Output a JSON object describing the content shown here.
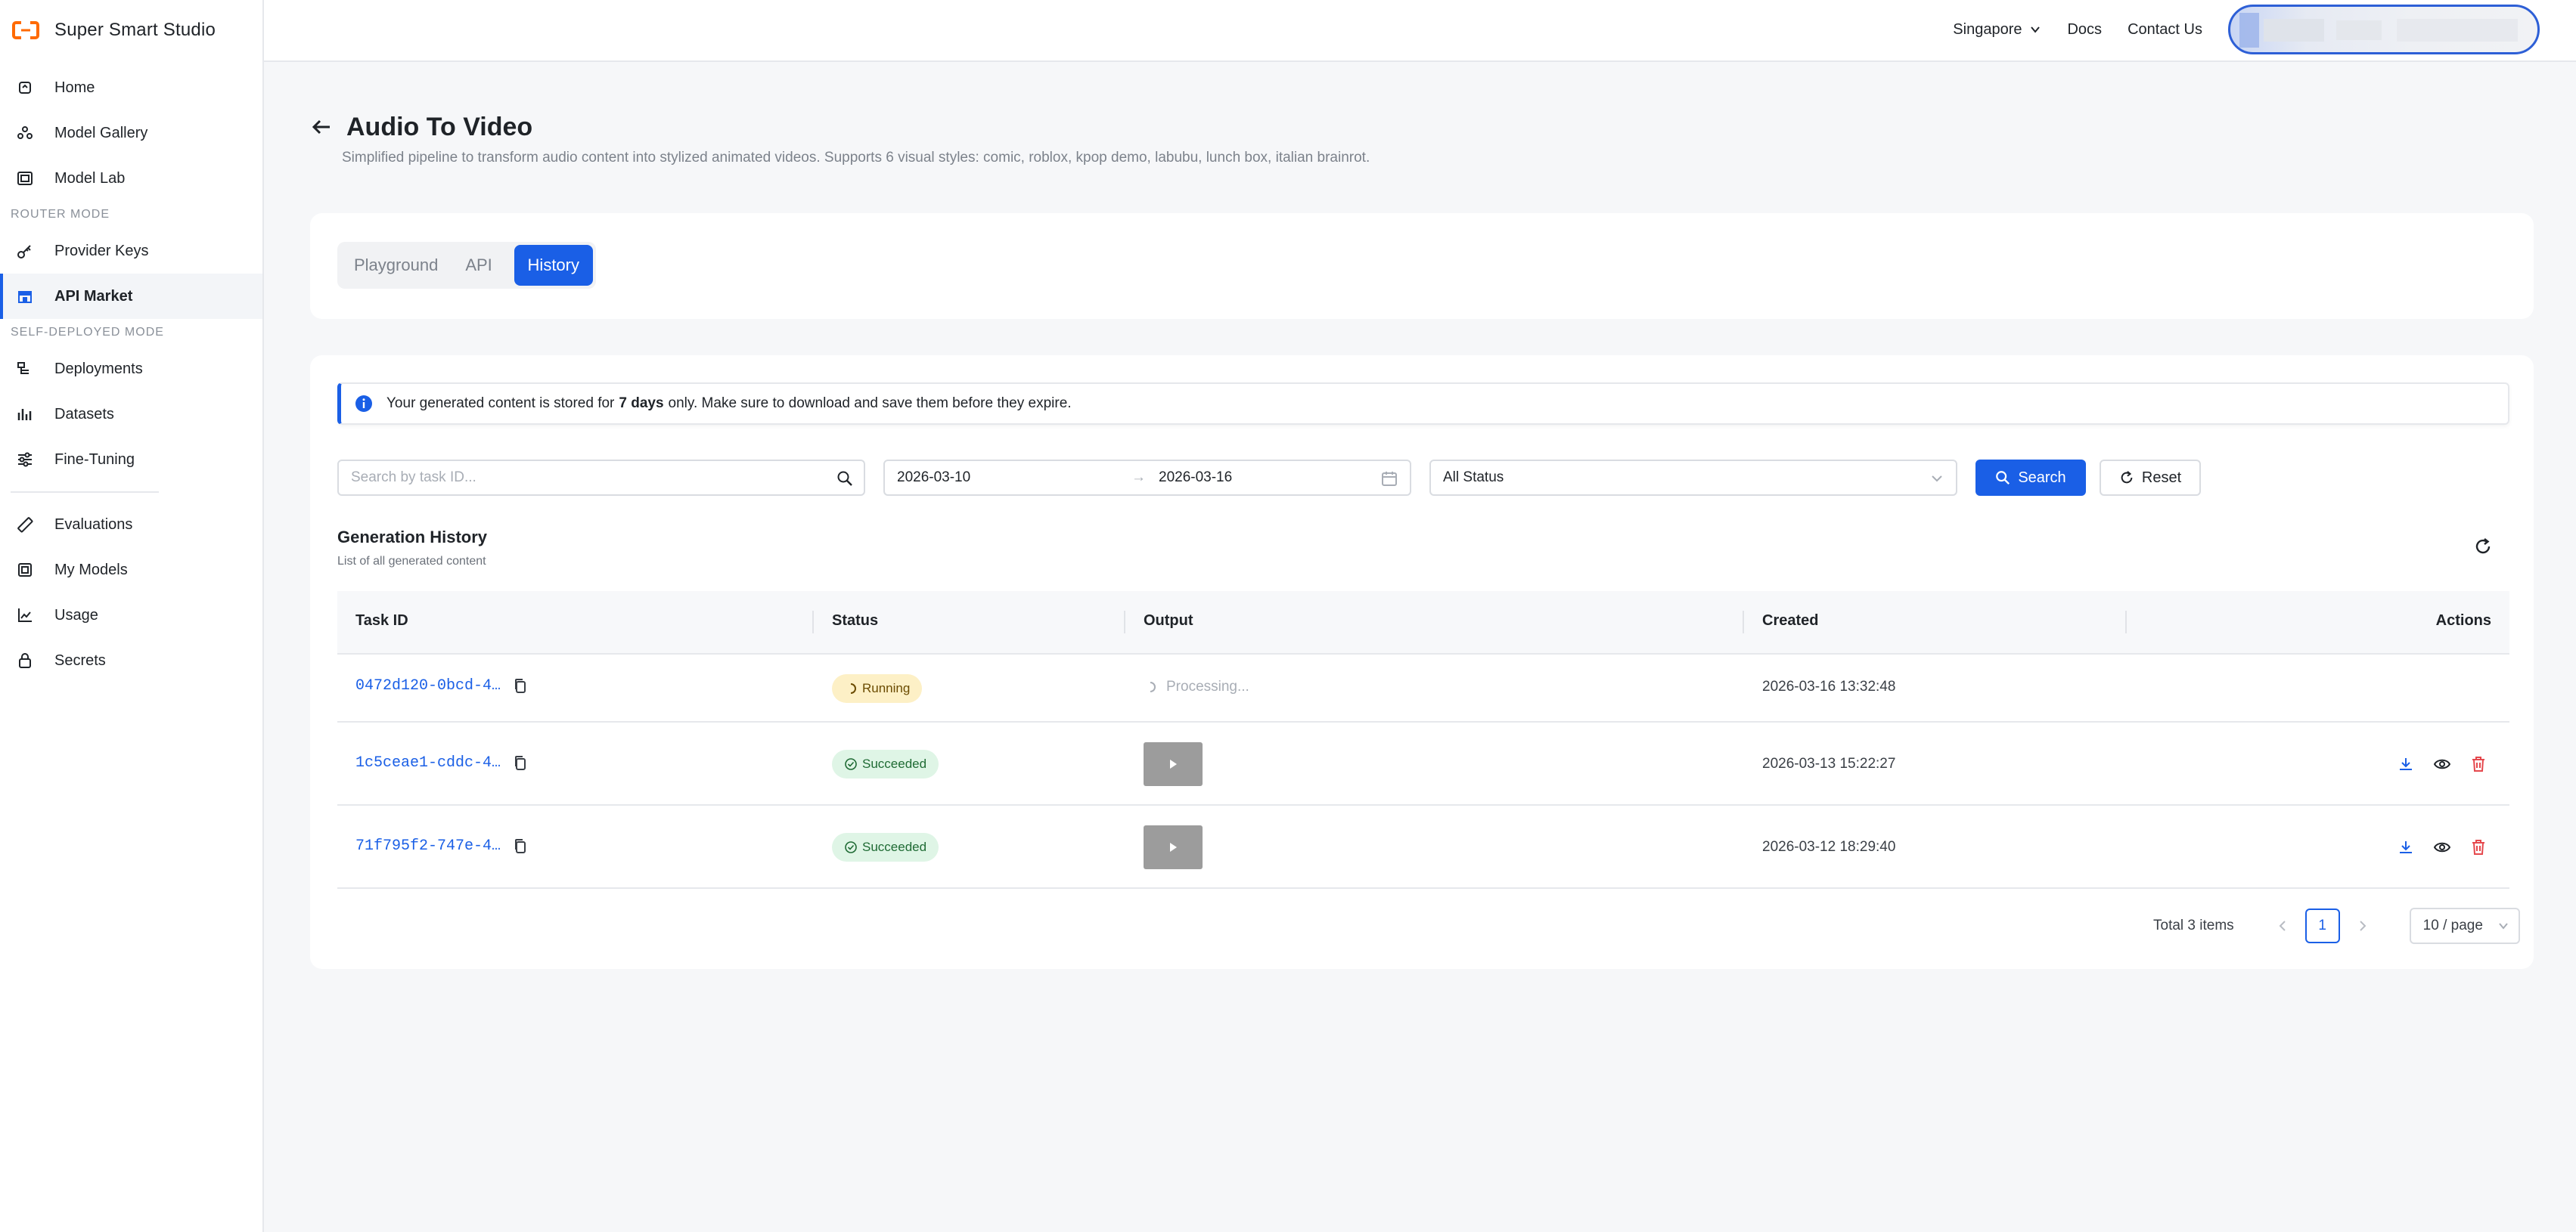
{
  "app": {
    "name": "Super Smart Studio",
    "accent_color": "#1a5fe6",
    "brand_color": "#ff6a00"
  },
  "topbar": {
    "region": "Singapore",
    "docs": "Docs",
    "contact": "Contact Us"
  },
  "sidebar": {
    "items": [
      {
        "label": "Home",
        "icon": "home-icon"
      },
      {
        "label": "Model Gallery",
        "icon": "model-gallery-icon"
      },
      {
        "label": "Model Lab",
        "icon": "model-lab-icon"
      }
    ],
    "router_section": "ROUTER MODE",
    "router_items": [
      {
        "label": "Provider Keys",
        "icon": "key-icon"
      },
      {
        "label": "API Market",
        "icon": "store-icon",
        "active": true
      }
    ],
    "self_section": "SELF-DEPLOYED MODE",
    "self_items": [
      {
        "label": "Deployments",
        "icon": "deployments-icon"
      },
      {
        "label": "Datasets",
        "icon": "datasets-icon"
      },
      {
        "label": "Fine-Tuning",
        "icon": "sliders-icon"
      }
    ],
    "other_items": [
      {
        "label": "Evaluations",
        "icon": "ruler-icon"
      },
      {
        "label": "My Models",
        "icon": "my-models-icon"
      },
      {
        "label": "Usage",
        "icon": "chart-icon"
      },
      {
        "label": "Secrets",
        "icon": "lock-icon"
      }
    ]
  },
  "page": {
    "title": "Audio To Video",
    "subtitle": "Simplified pipeline to transform audio content into stylized animated videos. Supports 6 visual styles: comic, roblox, kpop demo, labubu, lunch box, italian brainrot."
  },
  "tabs": [
    {
      "label": "Playground",
      "active": false
    },
    {
      "label": "API",
      "active": false
    },
    {
      "label": "History",
      "active": true
    }
  ],
  "notice": {
    "prefix": "Your generated content is stored for",
    "bold": "7 days",
    "suffix": "only. Make sure to download and save them before they expire."
  },
  "filters": {
    "search_placeholder": "Search by task ID...",
    "search_value": "",
    "date_start": "2026-03-10",
    "date_end": "2026-03-16",
    "status": "All Status",
    "search_button": "Search",
    "reset_button": "Reset"
  },
  "history": {
    "title": "Generation History",
    "subtitle": "List of all generated content",
    "columns": [
      "Task ID",
      "Status",
      "Output",
      "Created",
      "Actions"
    ],
    "rows": [
      {
        "task_id": "0472d120-0bcd-4…",
        "status": "Running",
        "output": "Processing...",
        "created": "2026-03-16 13:32:48"
      },
      {
        "task_id": "1c5ceae1-cddc-4…",
        "status": "Succeeded",
        "output": "video",
        "created": "2026-03-13 15:22:27"
      },
      {
        "task_id": "71f795f2-747e-4…",
        "status": "Succeeded",
        "output": "video",
        "created": "2026-03-12 18:29:40"
      }
    ]
  },
  "pagination": {
    "total": "Total 3 items",
    "current_page": "1",
    "page_size": "10 / page"
  }
}
